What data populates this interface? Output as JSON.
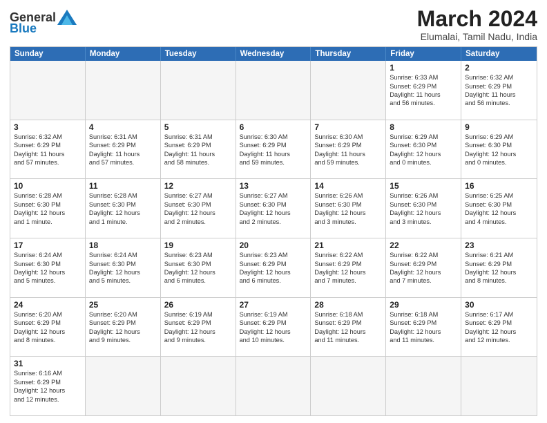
{
  "header": {
    "logo_general": "General",
    "logo_blue": "Blue",
    "month": "March 2024",
    "location": "Elumalai, Tamil Nadu, India"
  },
  "weekdays": [
    "Sunday",
    "Monday",
    "Tuesday",
    "Wednesday",
    "Thursday",
    "Friday",
    "Saturday"
  ],
  "rows": [
    [
      {
        "date": "",
        "info": ""
      },
      {
        "date": "",
        "info": ""
      },
      {
        "date": "",
        "info": ""
      },
      {
        "date": "",
        "info": ""
      },
      {
        "date": "",
        "info": ""
      },
      {
        "date": "1",
        "info": "Sunrise: 6:33 AM\nSunset: 6:29 PM\nDaylight: 11 hours\nand 56 minutes."
      },
      {
        "date": "2",
        "info": "Sunrise: 6:32 AM\nSunset: 6:29 PM\nDaylight: 11 hours\nand 56 minutes."
      }
    ],
    [
      {
        "date": "3",
        "info": "Sunrise: 6:32 AM\nSunset: 6:29 PM\nDaylight: 11 hours\nand 57 minutes."
      },
      {
        "date": "4",
        "info": "Sunrise: 6:31 AM\nSunset: 6:29 PM\nDaylight: 11 hours\nand 57 minutes."
      },
      {
        "date": "5",
        "info": "Sunrise: 6:31 AM\nSunset: 6:29 PM\nDaylight: 11 hours\nand 58 minutes."
      },
      {
        "date": "6",
        "info": "Sunrise: 6:30 AM\nSunset: 6:29 PM\nDaylight: 11 hours\nand 59 minutes."
      },
      {
        "date": "7",
        "info": "Sunrise: 6:30 AM\nSunset: 6:29 PM\nDaylight: 11 hours\nand 59 minutes."
      },
      {
        "date": "8",
        "info": "Sunrise: 6:29 AM\nSunset: 6:30 PM\nDaylight: 12 hours\nand 0 minutes."
      },
      {
        "date": "9",
        "info": "Sunrise: 6:29 AM\nSunset: 6:30 PM\nDaylight: 12 hours\nand 0 minutes."
      }
    ],
    [
      {
        "date": "10",
        "info": "Sunrise: 6:28 AM\nSunset: 6:30 PM\nDaylight: 12 hours\nand 1 minute."
      },
      {
        "date": "11",
        "info": "Sunrise: 6:28 AM\nSunset: 6:30 PM\nDaylight: 12 hours\nand 1 minute."
      },
      {
        "date": "12",
        "info": "Sunrise: 6:27 AM\nSunset: 6:30 PM\nDaylight: 12 hours\nand 2 minutes."
      },
      {
        "date": "13",
        "info": "Sunrise: 6:27 AM\nSunset: 6:30 PM\nDaylight: 12 hours\nand 2 minutes."
      },
      {
        "date": "14",
        "info": "Sunrise: 6:26 AM\nSunset: 6:30 PM\nDaylight: 12 hours\nand 3 minutes."
      },
      {
        "date": "15",
        "info": "Sunrise: 6:26 AM\nSunset: 6:30 PM\nDaylight: 12 hours\nand 3 minutes."
      },
      {
        "date": "16",
        "info": "Sunrise: 6:25 AM\nSunset: 6:30 PM\nDaylight: 12 hours\nand 4 minutes."
      }
    ],
    [
      {
        "date": "17",
        "info": "Sunrise: 6:24 AM\nSunset: 6:30 PM\nDaylight: 12 hours\nand 5 minutes."
      },
      {
        "date": "18",
        "info": "Sunrise: 6:24 AM\nSunset: 6:30 PM\nDaylight: 12 hours\nand 5 minutes."
      },
      {
        "date": "19",
        "info": "Sunrise: 6:23 AM\nSunset: 6:30 PM\nDaylight: 12 hours\nand 6 minutes."
      },
      {
        "date": "20",
        "info": "Sunrise: 6:23 AM\nSunset: 6:29 PM\nDaylight: 12 hours\nand 6 minutes."
      },
      {
        "date": "21",
        "info": "Sunrise: 6:22 AM\nSunset: 6:29 PM\nDaylight: 12 hours\nand 7 minutes."
      },
      {
        "date": "22",
        "info": "Sunrise: 6:22 AM\nSunset: 6:29 PM\nDaylight: 12 hours\nand 7 minutes."
      },
      {
        "date": "23",
        "info": "Sunrise: 6:21 AM\nSunset: 6:29 PM\nDaylight: 12 hours\nand 8 minutes."
      }
    ],
    [
      {
        "date": "24",
        "info": "Sunrise: 6:20 AM\nSunset: 6:29 PM\nDaylight: 12 hours\nand 8 minutes."
      },
      {
        "date": "25",
        "info": "Sunrise: 6:20 AM\nSunset: 6:29 PM\nDaylight: 12 hours\nand 9 minutes."
      },
      {
        "date": "26",
        "info": "Sunrise: 6:19 AM\nSunset: 6:29 PM\nDaylight: 12 hours\nand 9 minutes."
      },
      {
        "date": "27",
        "info": "Sunrise: 6:19 AM\nSunset: 6:29 PM\nDaylight: 12 hours\nand 10 minutes."
      },
      {
        "date": "28",
        "info": "Sunrise: 6:18 AM\nSunset: 6:29 PM\nDaylight: 12 hours\nand 11 minutes."
      },
      {
        "date": "29",
        "info": "Sunrise: 6:18 AM\nSunset: 6:29 PM\nDaylight: 12 hours\nand 11 minutes."
      },
      {
        "date": "30",
        "info": "Sunrise: 6:17 AM\nSunset: 6:29 PM\nDaylight: 12 hours\nand 12 minutes."
      }
    ],
    [
      {
        "date": "31",
        "info": "Sunrise: 6:16 AM\nSunset: 6:29 PM\nDaylight: 12 hours\nand 12 minutes."
      },
      {
        "date": "",
        "info": ""
      },
      {
        "date": "",
        "info": ""
      },
      {
        "date": "",
        "info": ""
      },
      {
        "date": "",
        "info": ""
      },
      {
        "date": "",
        "info": ""
      },
      {
        "date": "",
        "info": ""
      }
    ]
  ]
}
